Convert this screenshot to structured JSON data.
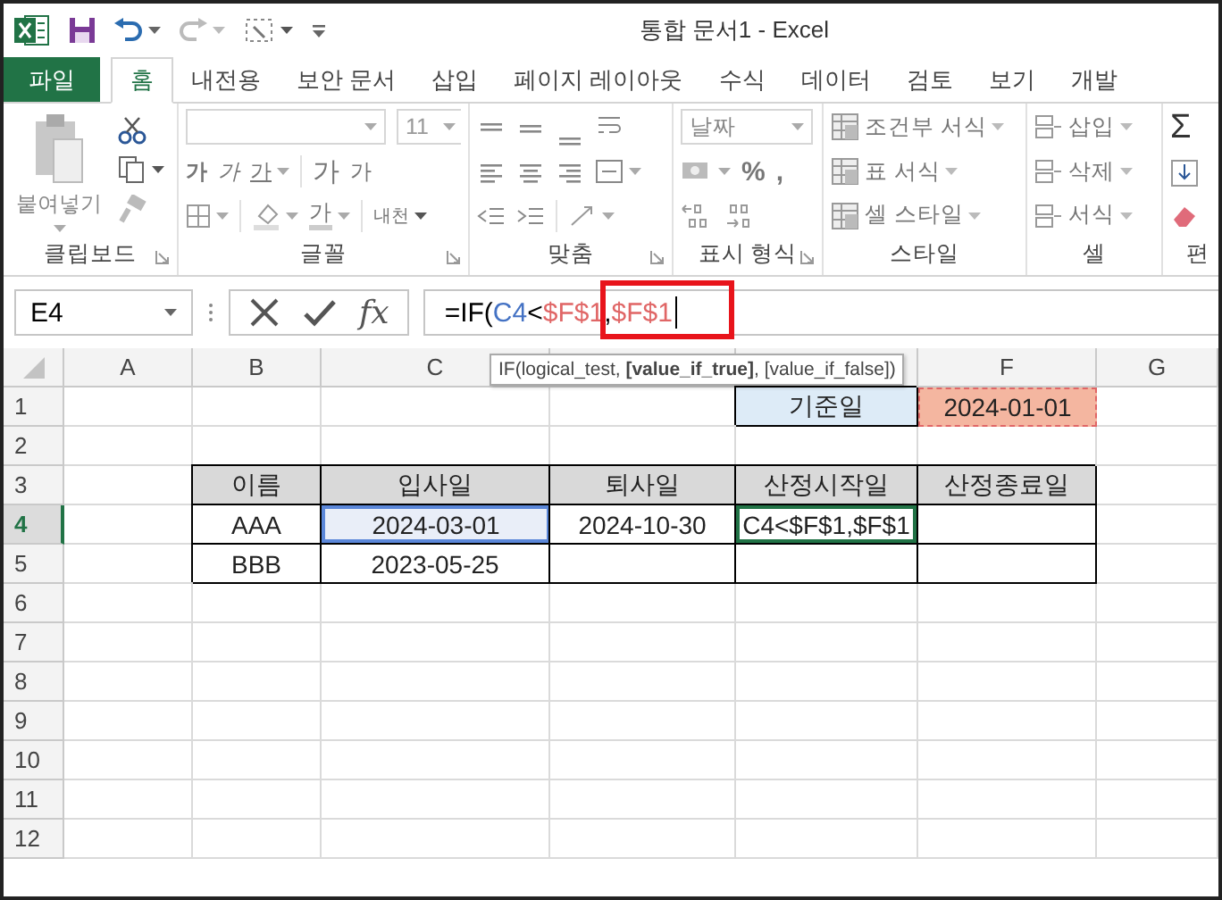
{
  "title_bar": {
    "title": "통합 문서1 - Excel"
  },
  "tabs": [
    {
      "label": "파일",
      "kind": "file",
      "selected": false
    },
    {
      "label": "홈",
      "kind": "tab",
      "selected": true
    },
    {
      "label": "내전용",
      "kind": "tab",
      "selected": false
    },
    {
      "label": "보안 문서",
      "kind": "tab",
      "selected": false
    },
    {
      "label": "삽입",
      "kind": "tab",
      "selected": false
    },
    {
      "label": "페이지 레이아웃",
      "kind": "tab",
      "selected": false
    },
    {
      "label": "수식",
      "kind": "tab",
      "selected": false
    },
    {
      "label": "데이터",
      "kind": "tab",
      "selected": false
    },
    {
      "label": "검토",
      "kind": "tab",
      "selected": false
    },
    {
      "label": "보기",
      "kind": "tab",
      "selected": false
    },
    {
      "label": "개발",
      "kind": "tab",
      "selected": false
    }
  ],
  "ribbon": {
    "clipboard": {
      "label": "클립보드",
      "paste": "붙여넣기"
    },
    "font": {
      "label": "글꼴",
      "size": "11",
      "style_buttons": [
        "가",
        "가",
        "가"
      ],
      "grow": "가",
      "shrink": "가",
      "font_color": "가",
      "phonetic": "내천"
    },
    "alignment": {
      "label": "맞춤"
    },
    "number": {
      "label": "표시 형식",
      "format": "날짜",
      "percent": "%",
      "comma": ","
    },
    "styles": {
      "label": "스타일",
      "items": [
        "조건부 서식",
        "표 서식",
        "셀 스타일"
      ]
    },
    "cells": {
      "label": "셀",
      "items": [
        "삽입",
        "삭제",
        "서식"
      ]
    },
    "editing": {
      "label": "편",
      "sum": "Σ"
    }
  },
  "formula_bar": {
    "name_box": "E4",
    "function_button": "fx",
    "highlight": true,
    "parts": [
      {
        "text": "=IF(",
        "color": "#000000"
      },
      {
        "text": "C4",
        "color": "#4472c4"
      },
      {
        "text": "<",
        "color": "#000000"
      },
      {
        "text": "$F$1",
        "color": "#e06666"
      },
      {
        "text": ",",
        "color": "#000000"
      },
      {
        "text": "$F$1",
        "color": "#e06666"
      }
    ]
  },
  "tooltip": "IF(logical_test, **[value_if_true]**, [value_if_false])",
  "sheet": {
    "columns": [
      {
        "label": "A"
      },
      {
        "label": "B"
      },
      {
        "label": "C"
      },
      {},
      {},
      {
        "label": "F"
      },
      {
        "label": "G"
      }
    ],
    "rows": [
      {
        "header": "1",
        "selected": false,
        "cells": [
          {},
          {},
          {},
          {},
          {
            "text": "기준일",
            "kind": "criteria-label"
          },
          {
            "text": "2024-01-01",
            "kind": "criteria-value"
          },
          {}
        ]
      },
      {
        "header": "2",
        "selected": false
      },
      {
        "header": "3",
        "selected": false,
        "cells": [
          {},
          {
            "text": "이름",
            "kind": "table-header"
          },
          {
            "text": "입사일",
            "kind": "table-header"
          },
          {
            "text": "퇴사일",
            "kind": "table-header"
          },
          {
            "text": "산정시작일",
            "kind": "table-header"
          },
          {
            "text": "산정종료일",
            "kind": "table-header"
          },
          {}
        ]
      },
      {
        "header": "4",
        "selected": true,
        "cells": [
          {},
          {
            "text": "AAA",
            "kind": "table"
          },
          {
            "text": "2024-03-01",
            "kind": "reference"
          },
          {
            "text": "2024-10-30",
            "kind": "table"
          },
          {
            "text": "C4<$F$1,$F$1",
            "kind": "active"
          },
          {
            "kind": "table"
          },
          {}
        ]
      },
      {
        "header": "5",
        "selected": false,
        "cells": [
          {},
          {
            "text": "BBB",
            "kind": "table"
          },
          {
            "text": "2023-05-25",
            "kind": "table"
          },
          {
            "kind": "table"
          },
          {
            "kind": "table"
          },
          {
            "kind": "table"
          },
          {}
        ]
      },
      {
        "header": "6",
        "selected": false
      },
      {
        "header": "7",
        "selected": false
      },
      {
        "header": "8",
        "selected": false
      },
      {
        "header": "9",
        "selected": false
      },
      {
        "header": "10",
        "selected": false
      },
      {
        "header": "11",
        "selected": false
      },
      {
        "header": "12",
        "selected": false
      }
    ]
  }
}
